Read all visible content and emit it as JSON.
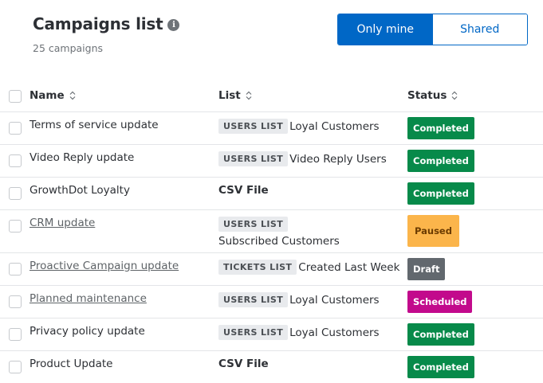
{
  "header": {
    "title": "Campaigns list",
    "info_icon": "info-icon",
    "count_text": "25 campaigns"
  },
  "toggle": {
    "only_mine": "Only mine",
    "shared": "Shared",
    "selected": "Only mine"
  },
  "table": {
    "columns": {
      "name": "Name",
      "list": "List",
      "status": "Status"
    },
    "rows": [
      {
        "name": "Terms of service update",
        "link": false,
        "list_type": "USERS LIST",
        "list_name": "Loyal Customers",
        "status": "Completed"
      },
      {
        "name": "Video Reply update",
        "link": false,
        "list_type": "USERS LIST",
        "list_name": "Video Reply Users",
        "status": "Completed"
      },
      {
        "name": "GrowthDot Loyalty",
        "link": false,
        "list_type": "",
        "list_name": "CSV File",
        "status": "Completed"
      },
      {
        "name": "CRM update",
        "link": true,
        "list_type": "USERS LIST",
        "list_name": "Subscribed Customers",
        "status": "Paused"
      },
      {
        "name": "Proactive Campaign update",
        "link": true,
        "list_type": "TICKETS LIST",
        "list_name": "Created Last Week",
        "status": "Draft"
      },
      {
        "name": "Planned maintenance",
        "link": true,
        "list_type": "USERS LIST",
        "list_name": "Loyal Customers",
        "status": "Scheduled"
      },
      {
        "name": "Privacy policy update",
        "link": false,
        "list_type": "USERS LIST",
        "list_name": "Loyal Customers",
        "status": "Completed"
      },
      {
        "name": "Product Update",
        "link": false,
        "list_type": "",
        "list_name": "CSV File",
        "status": "Completed"
      }
    ]
  },
  "status_colors": {
    "Completed": {
      "bg": "#078a4a",
      "fg": "#ffffff"
    },
    "Paused": {
      "bg": "#fbb54b",
      "fg": "#6b3b00"
    },
    "Draft": {
      "bg": "#62686e",
      "fg": "#ffffff"
    },
    "Scheduled": {
      "bg": "#c20a8c",
      "fg": "#ffffff"
    }
  },
  "colors": {
    "accent": "#0067c6"
  }
}
